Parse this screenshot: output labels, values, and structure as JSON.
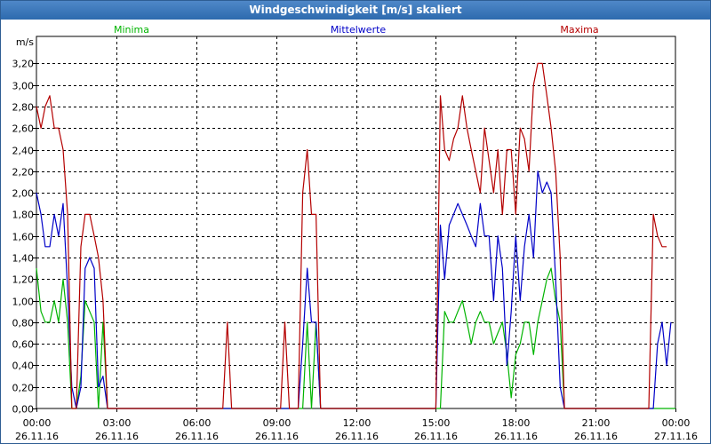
{
  "window": {
    "title": "Windgeschwindigkeit [m/s] skaliert"
  },
  "chart_data": {
    "type": "line",
    "title": "Windgeschwindigkeit [m/s] skaliert",
    "ylabel": "m/s",
    "xlabel": "",
    "ylim": [
      0,
      3.45
    ],
    "xlim_hours": [
      0,
      24
    ],
    "grid": true,
    "legend_position": "top",
    "y_ticks": [
      {
        "value": 0.0,
        "label": "0,00"
      },
      {
        "value": 0.2,
        "label": "0,20"
      },
      {
        "value": 0.4,
        "label": "0,40"
      },
      {
        "value": 0.6,
        "label": "0,60"
      },
      {
        "value": 0.8,
        "label": "0,80"
      },
      {
        "value": 1.0,
        "label": "1,00"
      },
      {
        "value": 1.2,
        "label": "1,20"
      },
      {
        "value": 1.4,
        "label": "1,40"
      },
      {
        "value": 1.6,
        "label": "1,60"
      },
      {
        "value": 1.8,
        "label": "1,80"
      },
      {
        "value": 2.0,
        "label": "2,00"
      },
      {
        "value": 2.2,
        "label": "2,20"
      },
      {
        "value": 2.4,
        "label": "2,40"
      },
      {
        "value": 2.6,
        "label": "2,60"
      },
      {
        "value": 2.8,
        "label": "2,80"
      },
      {
        "value": 3.0,
        "label": "3,00"
      },
      {
        "value": 3.2,
        "label": "3,20"
      }
    ],
    "x_ticks": [
      {
        "hour": 0,
        "time": "00:00",
        "date": "26.11.16"
      },
      {
        "hour": 3,
        "time": "03:00",
        "date": "26.11.16"
      },
      {
        "hour": 6,
        "time": "06:00",
        "date": "26.11.16"
      },
      {
        "hour": 9,
        "time": "09:00",
        "date": "26.11.16"
      },
      {
        "hour": 12,
        "time": "12:00",
        "date": "26.11.16"
      },
      {
        "hour": 15,
        "time": "15:00",
        "date": "26.11.16"
      },
      {
        "hour": 18,
        "time": "18:00",
        "date": "26.11.16"
      },
      {
        "hour": 21,
        "time": "21:00",
        "date": "26.11.16"
      },
      {
        "hour": 24,
        "time": "00:00",
        "date": "27.11.16"
      }
    ],
    "series": [
      {
        "name": "Minima",
        "color": "#00b400",
        "points": [
          [
            0,
            1.3
          ],
          [
            0.17,
            0.9
          ],
          [
            0.33,
            0.8
          ],
          [
            0.5,
            0.8
          ],
          [
            0.67,
            1.0
          ],
          [
            0.83,
            0.8
          ],
          [
            1.0,
            1.2
          ],
          [
            1.17,
            0.8
          ],
          [
            1.33,
            0.0
          ],
          [
            1.5,
            0.0
          ],
          [
            1.67,
            0.3
          ],
          [
            1.83,
            1.0
          ],
          [
            2.0,
            0.9
          ],
          [
            2.17,
            0.8
          ],
          [
            2.33,
            0.0
          ],
          [
            2.5,
            0.8
          ],
          [
            2.67,
            0.0
          ],
          [
            2.83,
            0.0
          ],
          [
            3.0,
            0.0
          ],
          [
            10.0,
            0.0
          ],
          [
            10.17,
            0.8
          ],
          [
            10.33,
            0.0
          ],
          [
            10.5,
            0.8
          ],
          [
            10.67,
            0.0
          ],
          [
            11.0,
            0.0
          ],
          [
            15.0,
            0.0
          ],
          [
            15.17,
            0.0
          ],
          [
            15.33,
            0.9
          ],
          [
            15.5,
            0.8
          ],
          [
            15.67,
            0.8
          ],
          [
            15.83,
            0.9
          ],
          [
            16.0,
            1.0
          ],
          [
            16.17,
            0.8
          ],
          [
            16.33,
            0.6
          ],
          [
            16.5,
            0.8
          ],
          [
            16.67,
            0.9
          ],
          [
            16.83,
            0.8
          ],
          [
            17.0,
            0.8
          ],
          [
            17.17,
            0.6
          ],
          [
            17.33,
            0.7
          ],
          [
            17.5,
            0.8
          ],
          [
            17.67,
            0.5
          ],
          [
            17.83,
            0.1
          ],
          [
            18.0,
            0.5
          ],
          [
            18.17,
            0.6
          ],
          [
            18.33,
            0.8
          ],
          [
            18.5,
            0.8
          ],
          [
            18.67,
            0.5
          ],
          [
            18.83,
            0.8
          ],
          [
            19.0,
            1.0
          ],
          [
            19.17,
            1.2
          ],
          [
            19.33,
            1.3
          ],
          [
            19.5,
            1.0
          ],
          [
            19.67,
            0.8
          ],
          [
            19.83,
            0.0
          ],
          [
            20.0,
            0.0
          ],
          [
            24.0,
            0.0
          ]
        ]
      },
      {
        "name": "Mittelwerte",
        "color": "#0000c8",
        "points": [
          [
            0,
            2.0
          ],
          [
            0.17,
            1.8
          ],
          [
            0.33,
            1.5
          ],
          [
            0.5,
            1.5
          ],
          [
            0.67,
            1.8
          ],
          [
            0.83,
            1.6
          ],
          [
            1.0,
            1.9
          ],
          [
            1.17,
            1.1
          ],
          [
            1.33,
            0.2
          ],
          [
            1.5,
            0.0
          ],
          [
            1.67,
            0.2
          ],
          [
            1.83,
            1.3
          ],
          [
            2.0,
            1.4
          ],
          [
            2.17,
            1.3
          ],
          [
            2.33,
            0.2
          ],
          [
            2.5,
            0.3
          ],
          [
            2.67,
            0.0
          ],
          [
            2.83,
            0.0
          ],
          [
            3.0,
            0.0
          ],
          [
            9.83,
            0.0
          ],
          [
            10.0,
            0.6
          ],
          [
            10.17,
            1.3
          ],
          [
            10.33,
            0.8
          ],
          [
            10.5,
            0.8
          ],
          [
            10.67,
            0.0
          ],
          [
            11.0,
            0.0
          ],
          [
            15.0,
            0.0
          ],
          [
            15.17,
            1.7
          ],
          [
            15.33,
            1.2
          ],
          [
            15.5,
            1.7
          ],
          [
            15.67,
            1.8
          ],
          [
            15.83,
            1.9
          ],
          [
            16.0,
            1.8
          ],
          [
            16.17,
            1.7
          ],
          [
            16.33,
            1.6
          ],
          [
            16.5,
            1.5
          ],
          [
            16.67,
            1.9
          ],
          [
            16.83,
            1.6
          ],
          [
            17.0,
            1.6
          ],
          [
            17.17,
            1.0
          ],
          [
            17.33,
            1.6
          ],
          [
            17.5,
            1.3
          ],
          [
            17.67,
            0.4
          ],
          [
            17.83,
            0.9
          ],
          [
            18.0,
            1.6
          ],
          [
            18.17,
            1.0
          ],
          [
            18.33,
            1.5
          ],
          [
            18.5,
            1.8
          ],
          [
            18.67,
            1.4
          ],
          [
            18.83,
            2.2
          ],
          [
            19.0,
            2.0
          ],
          [
            19.17,
            2.1
          ],
          [
            19.33,
            2.0
          ],
          [
            19.5,
            1.2
          ],
          [
            19.67,
            0.2
          ],
          [
            19.83,
            0.0
          ],
          [
            20.0,
            0.0
          ],
          [
            23.17,
            0.0
          ],
          [
            23.33,
            0.6
          ],
          [
            23.5,
            0.8
          ],
          [
            23.67,
            0.4
          ],
          [
            23.83,
            0.8
          ]
        ]
      },
      {
        "name": "Maxima",
        "color": "#b40000",
        "points": [
          [
            0,
            2.8
          ],
          [
            0.17,
            2.6
          ],
          [
            0.33,
            2.8
          ],
          [
            0.5,
            2.9
          ],
          [
            0.67,
            2.6
          ],
          [
            0.83,
            2.6
          ],
          [
            1.0,
            2.4
          ],
          [
            1.17,
            1.8
          ],
          [
            1.33,
            0.0
          ],
          [
            1.5,
            0.0
          ],
          [
            1.67,
            1.5
          ],
          [
            1.83,
            1.8
          ],
          [
            2.0,
            1.8
          ],
          [
            2.17,
            1.6
          ],
          [
            2.33,
            1.4
          ],
          [
            2.5,
            1.0
          ],
          [
            2.67,
            0.0
          ],
          [
            3.0,
            0.0
          ],
          [
            7.0,
            0.0
          ],
          [
            7.17,
            0.8
          ],
          [
            7.33,
            0.0
          ],
          [
            7.5,
            0.0
          ],
          [
            9.17,
            0.0
          ],
          [
            9.33,
            0.8
          ],
          [
            9.5,
            0.0
          ],
          [
            9.83,
            0.0
          ],
          [
            10.0,
            2.0
          ],
          [
            10.17,
            2.4
          ],
          [
            10.33,
            1.8
          ],
          [
            10.5,
            1.8
          ],
          [
            10.67,
            0.0
          ],
          [
            11.0,
            0.0
          ],
          [
            15.0,
            0.0
          ],
          [
            15.17,
            2.9
          ],
          [
            15.33,
            2.4
          ],
          [
            15.5,
            2.3
          ],
          [
            15.67,
            2.5
          ],
          [
            15.83,
            2.6
          ],
          [
            16.0,
            2.9
          ],
          [
            16.17,
            2.6
          ],
          [
            16.33,
            2.4
          ],
          [
            16.5,
            2.2
          ],
          [
            16.67,
            2.0
          ],
          [
            16.83,
            2.6
          ],
          [
            17.0,
            2.3
          ],
          [
            17.17,
            2.0
          ],
          [
            17.33,
            2.4
          ],
          [
            17.5,
            1.8
          ],
          [
            17.67,
            2.4
          ],
          [
            17.83,
            2.4
          ],
          [
            18.0,
            1.8
          ],
          [
            18.17,
            2.6
          ],
          [
            18.33,
            2.5
          ],
          [
            18.5,
            2.2
          ],
          [
            18.67,
            3.0
          ],
          [
            18.83,
            3.2
          ],
          [
            19.0,
            3.2
          ],
          [
            19.17,
            2.9
          ],
          [
            19.33,
            2.6
          ],
          [
            19.5,
            2.2
          ],
          [
            19.67,
            1.4
          ],
          [
            19.83,
            0.0
          ],
          [
            20.0,
            0.0
          ],
          [
            23.0,
            0.0
          ],
          [
            23.17,
            1.8
          ],
          [
            23.33,
            1.6
          ],
          [
            23.5,
            1.5
          ],
          [
            23.67,
            1.5
          ]
        ]
      }
    ]
  }
}
